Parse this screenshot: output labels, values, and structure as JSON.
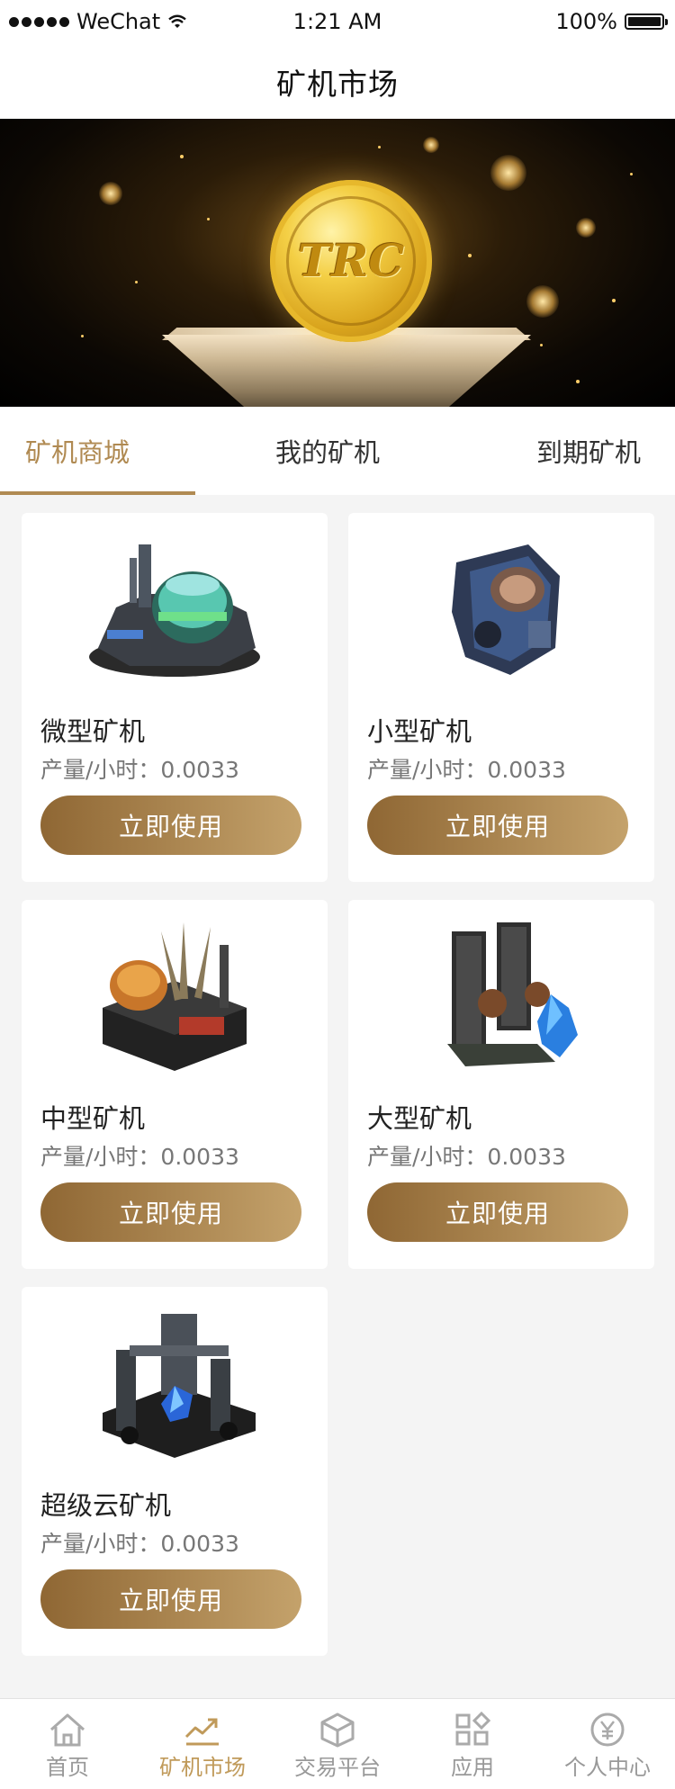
{
  "status_bar": {
    "carrier": "WeChat",
    "time": "1:21 AM",
    "battery": "100%"
  },
  "nav": {
    "title": "矿机市场"
  },
  "banner": {
    "coin_text": "TRC"
  },
  "tabs": [
    {
      "label": "矿机商城",
      "active": true
    },
    {
      "label": "我的矿机",
      "active": false
    },
    {
      "label": "到期矿机",
      "active": false
    }
  ],
  "cards": [
    {
      "name": "微型矿机",
      "output": "产量/小时：0.0033",
      "button": "立即使用"
    },
    {
      "name": "小型矿机",
      "output": "产量/小时：0.0033",
      "button": "立即使用"
    },
    {
      "name": "中型矿机",
      "output": "产量/小时：0.0033",
      "button": "立即使用"
    },
    {
      "name": "大型矿机",
      "output": "产量/小时：0.0033",
      "button": "立即使用"
    },
    {
      "name": "超级云矿机",
      "output": "产量/小时：0.0033",
      "button": "立即使用"
    }
  ],
  "tabbar": [
    {
      "label": "首页",
      "icon": "home-icon",
      "active": false
    },
    {
      "label": "矿机市场",
      "icon": "chart-icon",
      "active": true
    },
    {
      "label": "交易平台",
      "icon": "cube-icon",
      "active": false
    },
    {
      "label": "应用",
      "icon": "apps-icon",
      "active": false
    },
    {
      "label": "个人中心",
      "icon": "yen-circle-icon",
      "active": false
    }
  ],
  "colors": {
    "accent": "#b08a52",
    "button_start": "#8f6734",
    "button_end": "#c4a26b",
    "background": "#f4f4f4"
  }
}
